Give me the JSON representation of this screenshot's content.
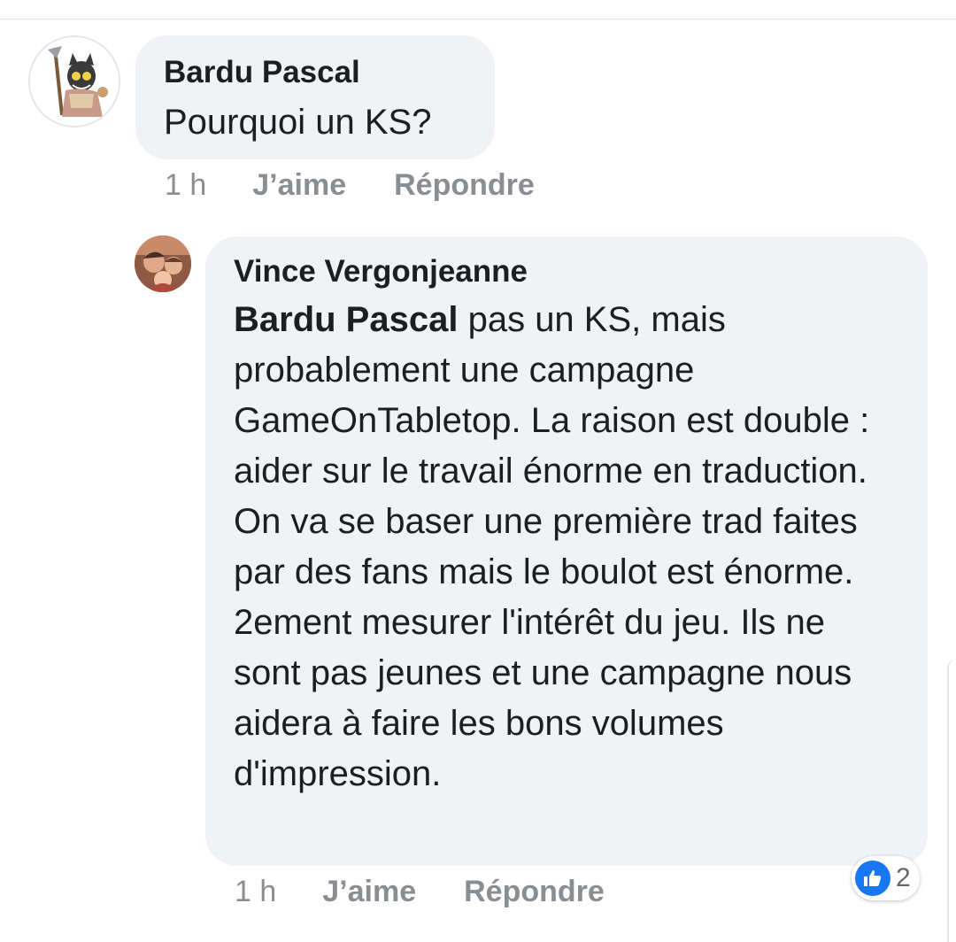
{
  "comments": [
    {
      "author": "Bardu Pascal",
      "text": "Pourquoi un KS?",
      "time": "1 h",
      "like_label": "J’aime",
      "reply_label": "Répondre"
    }
  ],
  "replies": [
    {
      "author": "Vince Vergonjeanne",
      "mention": "Bardu Pascal",
      "text": " pas un KS, mais probablement une campagne GameOnTabletop. La raison est double : aider sur le travail énorme en traduction. On va se baser une première trad faites par des fans mais le boulot est énorme. 2ement mesurer l'intérêt du jeu. Ils ne sont pas jeunes et une campagne nous aidera à faire les bons volumes d'impression.",
      "time": "1 h",
      "like_label": "J’aime",
      "reply_label": "Répondre",
      "reaction": {
        "icon": "thumbs-up-icon",
        "count": "2",
        "color": "#1877f2"
      }
    }
  ],
  "colors": {
    "bubble": "#f0f2f5",
    "meta_text": "#8a8d91",
    "like_blue": "#1877f2"
  }
}
